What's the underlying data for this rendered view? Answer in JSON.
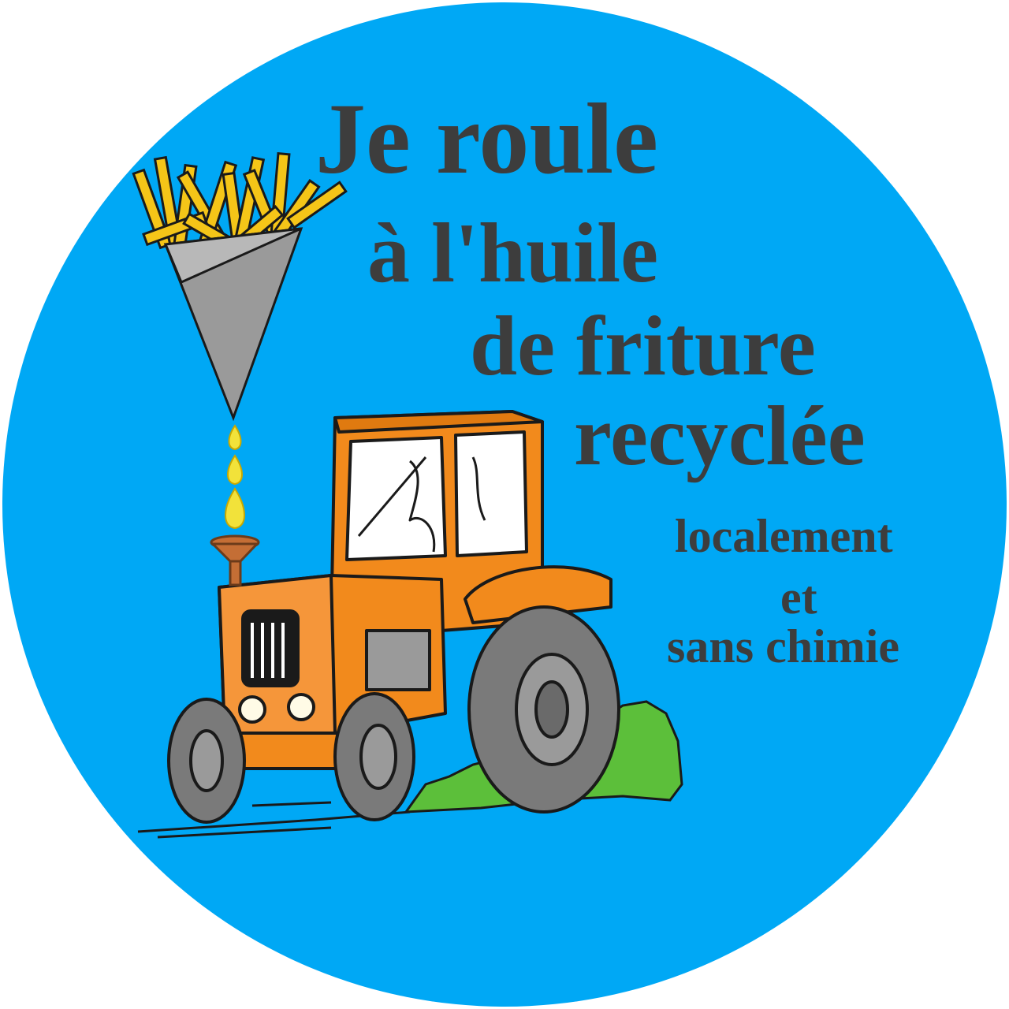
{
  "badge": {
    "background_color": "#00a8f5",
    "headline": {
      "line1": "Je roule",
      "line2": "à l'huile",
      "line3": "de friture",
      "line4": "recyclée"
    },
    "subline": {
      "line1": "localement",
      "line2": "et",
      "line3": "sans chimie"
    },
    "colors": {
      "text": "#3d3d3d",
      "tractor": "#f28a1c",
      "fries": "#f5c518",
      "cone": "#9a9a9a",
      "grass": "#5cbf3a",
      "oil_drop": "#f2e23a",
      "tire": "#7a7a7a"
    },
    "icons": [
      "fries-cone-icon",
      "oil-drops-icon",
      "funnel-icon",
      "tractor-icon",
      "grass-icon"
    ]
  }
}
